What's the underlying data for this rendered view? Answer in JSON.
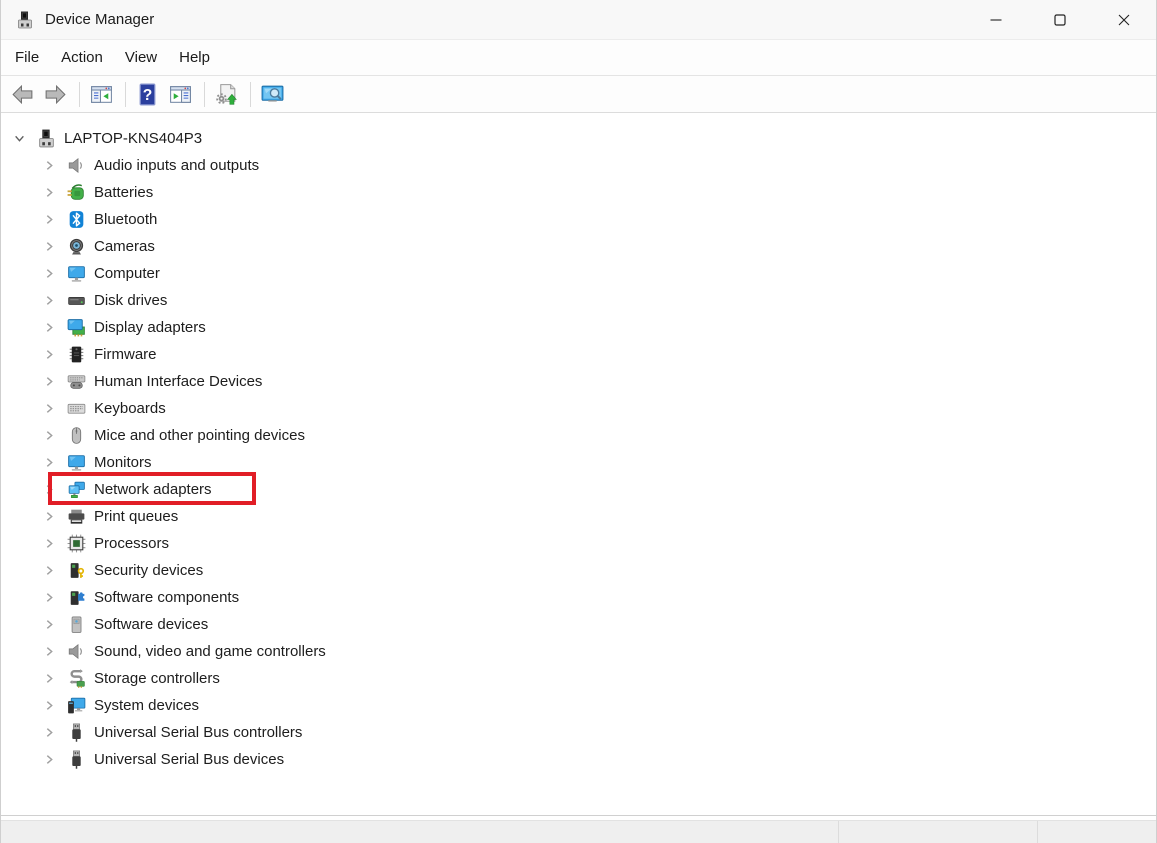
{
  "window": {
    "title": "Device Manager"
  },
  "titlebar": {
    "app_icon": "device-manager-icon",
    "controls": [
      {
        "name": "minimize",
        "icon": "minimize-icon"
      },
      {
        "name": "maximize",
        "icon": "maximize-icon"
      },
      {
        "name": "close",
        "icon": "close-icon"
      }
    ]
  },
  "menu": {
    "items": [
      {
        "label": "File"
      },
      {
        "label": "Action"
      },
      {
        "label": "View"
      },
      {
        "label": "Help"
      }
    ]
  },
  "toolbar": {
    "buttons": [
      {
        "name": "back",
        "icon": "back-arrow-icon"
      },
      {
        "name": "forward",
        "icon": "forward-arrow-icon"
      },
      {
        "name": "show-hide-console-tree",
        "icon": "console-tree-icon"
      },
      {
        "name": "help",
        "icon": "help-icon"
      },
      {
        "name": "show-hide-action-pane",
        "icon": "action-pane-icon"
      },
      {
        "name": "scan-for-hardware-changes",
        "icon": "scan-hardware-icon"
      },
      {
        "name": "device-search",
        "icon": "monitor-search-icon"
      }
    ]
  },
  "tree": {
    "items": [
      {
        "label": "LAPTOP-KNS404P3",
        "icon": "device-manager",
        "root": true,
        "expanded": true
      },
      {
        "label": "Audio inputs and outputs",
        "icon": "audio"
      },
      {
        "label": "Batteries",
        "icon": "battery"
      },
      {
        "label": "Bluetooth",
        "icon": "bluetooth"
      },
      {
        "label": "Cameras",
        "icon": "camera"
      },
      {
        "label": "Computer",
        "icon": "monitor"
      },
      {
        "label": "Disk drives",
        "icon": "disk"
      },
      {
        "label": "Display adapters",
        "icon": "display-adapter"
      },
      {
        "label": "Firmware",
        "icon": "firmware"
      },
      {
        "label": "Human Interface Devices",
        "icon": "hid"
      },
      {
        "label": "Keyboards",
        "icon": "keyboard"
      },
      {
        "label": "Mice and other pointing devices",
        "icon": "mouse"
      },
      {
        "label": "Monitors",
        "icon": "monitor"
      },
      {
        "label": "Network adapters",
        "icon": "network",
        "highlighted": true
      },
      {
        "label": "Print queues",
        "icon": "printer"
      },
      {
        "label": "Processors",
        "icon": "processor"
      },
      {
        "label": "Security devices",
        "icon": "security"
      },
      {
        "label": "Software components",
        "icon": "software-component"
      },
      {
        "label": "Software devices",
        "icon": "software-device"
      },
      {
        "label": "Sound, video and game controllers",
        "icon": "audio"
      },
      {
        "label": "Storage controllers",
        "icon": "storage"
      },
      {
        "label": "System devices",
        "icon": "system"
      },
      {
        "label": "Universal Serial Bus controllers",
        "icon": "usb"
      },
      {
        "label": "Universal Serial Bus devices",
        "icon": "usb"
      }
    ]
  },
  "annotation": {
    "highlight_color": "#e11d26",
    "target": "Network adapters"
  },
  "colors": {
    "monitor_blue": "#3fa9ea",
    "device_green": "#43b049",
    "statusbar_bg": "#efefef"
  }
}
